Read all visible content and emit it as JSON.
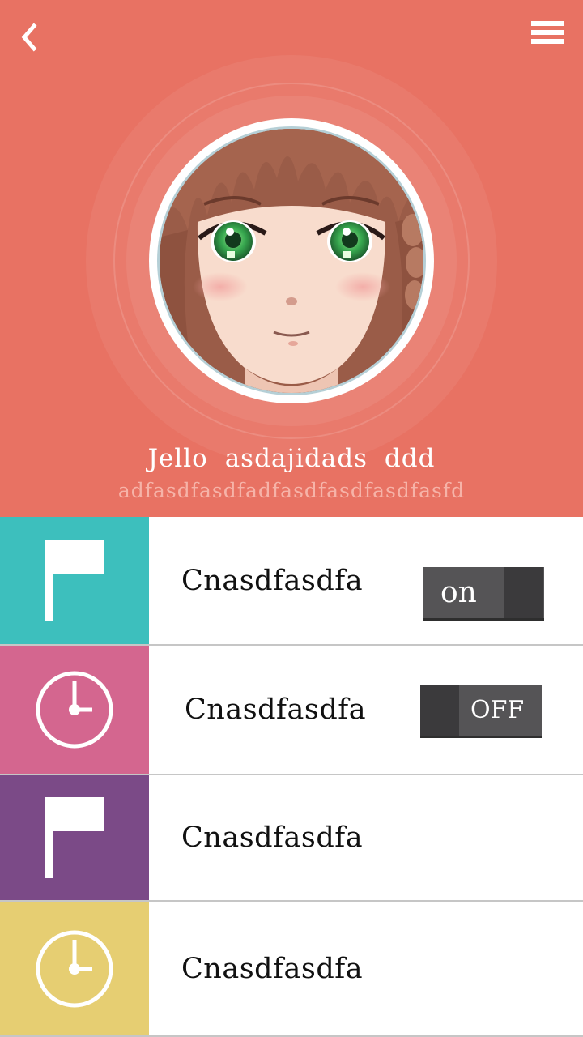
{
  "header": {
    "background": "#e87263",
    "back_icon": "chevron-left-icon",
    "menu_icon": "hamburger-menu-icon"
  },
  "profile": {
    "name": "Jello asdajidads ddd",
    "subtitle": "adfasdfasdfadfasdfasdfasdfasfd"
  },
  "list": {
    "items": [
      {
        "label": "Cnasdfasdfa",
        "icon": "flag-icon",
        "color": "#3dbfbd",
        "toggle": {
          "state": "on",
          "label": "on"
        }
      },
      {
        "label": "Cnasdfasdfa",
        "icon": "clock-icon",
        "color": "#d4668f",
        "toggle": {
          "state": "off",
          "label": "OFF"
        }
      },
      {
        "label": "Cnasdfasdfa",
        "icon": "flag-icon",
        "color": "#7b4a87"
      },
      {
        "label": "Cnasdfasdfa",
        "icon": "clock-icon",
        "color": "#e6ce72"
      }
    ]
  }
}
